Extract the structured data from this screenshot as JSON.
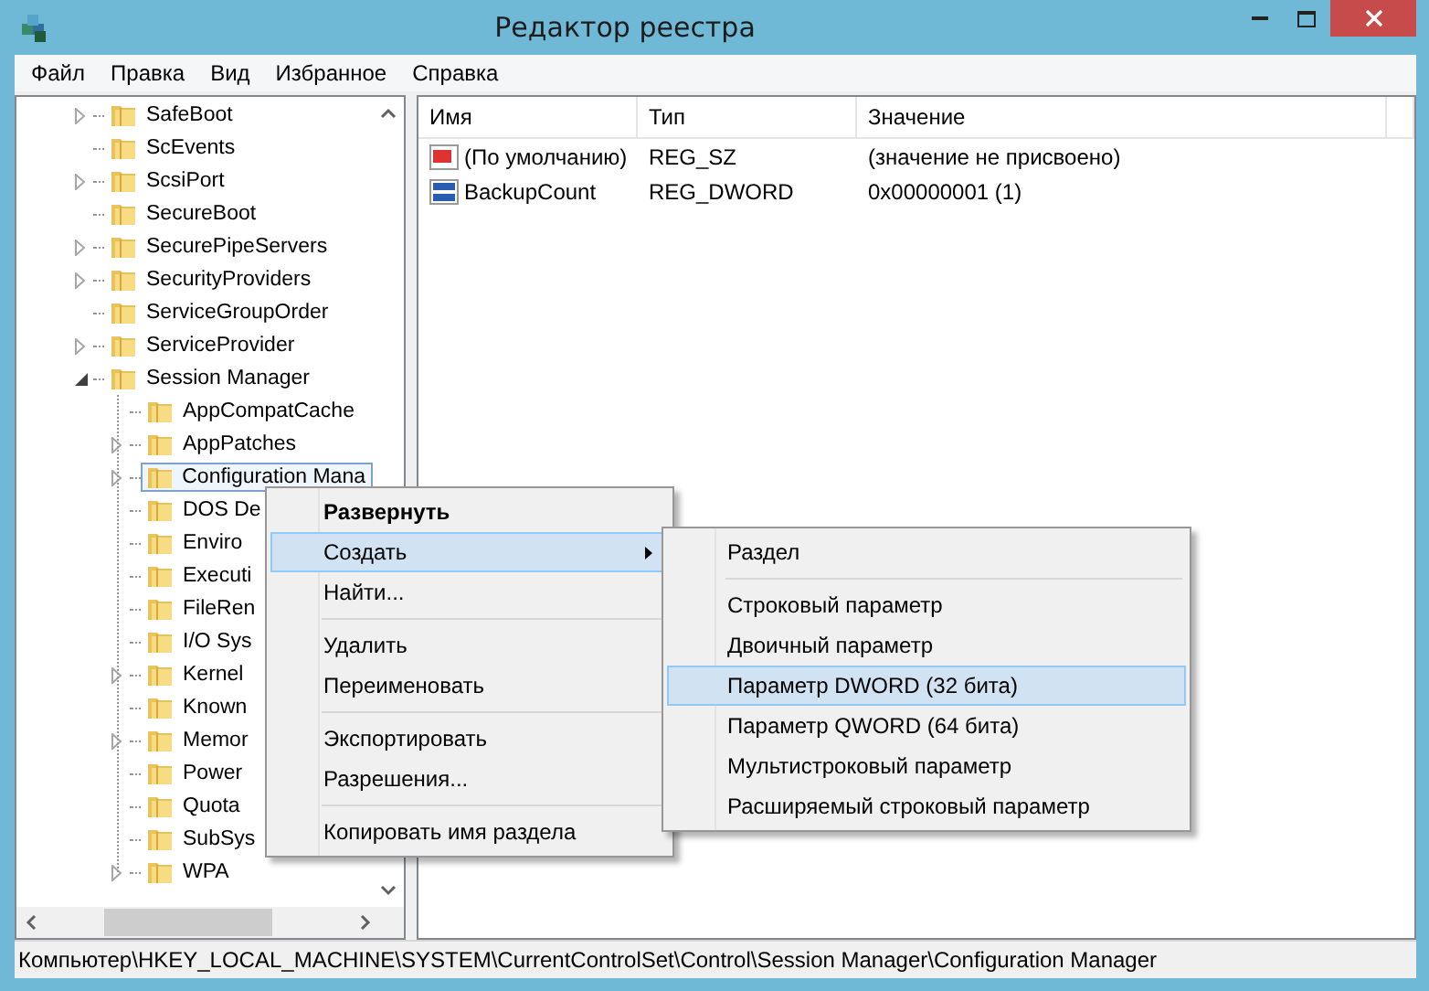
{
  "window": {
    "title": "Редактор реестра"
  },
  "menu_bar": [
    "Файл",
    "Правка",
    "Вид",
    "Избранное",
    "Справка"
  ],
  "tree": {
    "items": [
      {
        "name": "SafeBoot",
        "expandable": true,
        "expanded": false,
        "selected": false
      },
      {
        "name": "ScEvents",
        "expandable": false,
        "selected": false
      },
      {
        "name": "ScsiPort",
        "expandable": true,
        "expanded": false,
        "selected": false
      },
      {
        "name": "SecureBoot",
        "expandable": false,
        "selected": false
      },
      {
        "name": "SecurePipeServers",
        "expandable": true,
        "expanded": false,
        "selected": false
      },
      {
        "name": "SecurityProviders",
        "expandable": true,
        "expanded": false,
        "selected": false
      },
      {
        "name": "ServiceGroupOrder",
        "expandable": false,
        "selected": false
      },
      {
        "name": "ServiceProvider",
        "expandable": true,
        "expanded": false,
        "selected": false
      },
      {
        "name": "Session Manager",
        "expandable": true,
        "expanded": true,
        "selected": false,
        "children": [
          {
            "name": "AppCompatCache",
            "expandable": false,
            "selected": false
          },
          {
            "name": "AppPatches",
            "expandable": true,
            "expanded": false,
            "selected": false
          },
          {
            "name": "Configuration Mana",
            "expandable": true,
            "expanded": false,
            "selected": true
          },
          {
            "name": "DOS De",
            "expandable": false,
            "selected": false
          },
          {
            "name": "Enviro",
            "expandable": false,
            "selected": false
          },
          {
            "name": "Executi",
            "expandable": false,
            "selected": false
          },
          {
            "name": "FileRen",
            "expandable": false,
            "selected": false
          },
          {
            "name": "I/O Sys",
            "expandable": false,
            "selected": false
          },
          {
            "name": "Kernel",
            "expandable": true,
            "expanded": false,
            "selected": false
          },
          {
            "name": "Known",
            "expandable": false,
            "selected": false
          },
          {
            "name": "Memor",
            "expandable": true,
            "expanded": false,
            "selected": false
          },
          {
            "name": "Power",
            "expandable": false,
            "selected": false
          },
          {
            "name": "Quota",
            "expandable": false,
            "selected": false
          },
          {
            "name": "SubSys",
            "expandable": false,
            "selected": false
          },
          {
            "name": "WPA",
            "expandable": true,
            "expanded": false,
            "selected": false
          }
        ]
      }
    ]
  },
  "values": {
    "columns": [
      "Имя",
      "Тип",
      "Значение"
    ],
    "rows": [
      {
        "kind": "string",
        "name": "(По умолчанию)",
        "type": "REG_SZ",
        "data": "(значение не присвоено)"
      },
      {
        "kind": "binary",
        "name": "BackupCount",
        "type": "REG_DWORD",
        "data": "0x00000001 (1)"
      }
    ]
  },
  "context_menu": {
    "items": [
      {
        "kind": "item",
        "label": "Развернуть",
        "bold": true,
        "selected": false,
        "submenu": false
      },
      {
        "kind": "item",
        "label": "Создать",
        "bold": false,
        "selected": true,
        "submenu": true
      },
      {
        "kind": "item",
        "label": "Найти...",
        "bold": false,
        "selected": false,
        "submenu": false
      },
      {
        "kind": "separator"
      },
      {
        "kind": "item",
        "label": "Удалить",
        "bold": false,
        "selected": false,
        "submenu": false
      },
      {
        "kind": "item",
        "label": "Переименовать",
        "bold": false,
        "selected": false,
        "submenu": false
      },
      {
        "kind": "separator"
      },
      {
        "kind": "item",
        "label": "Экспортировать",
        "bold": false,
        "selected": false,
        "submenu": false
      },
      {
        "kind": "item",
        "label": "Разрешения...",
        "bold": false,
        "selected": false,
        "submenu": false
      },
      {
        "kind": "separator"
      },
      {
        "kind": "item",
        "label": "Копировать имя раздела",
        "bold": false,
        "selected": false,
        "submenu": false
      }
    ]
  },
  "submenu": {
    "items": [
      {
        "kind": "item",
        "label": "Раздел",
        "selected": false
      },
      {
        "kind": "separator"
      },
      {
        "kind": "item",
        "label": "Строковый параметр",
        "selected": false
      },
      {
        "kind": "item",
        "label": "Двоичный параметр",
        "selected": false
      },
      {
        "kind": "item",
        "label": "Параметр DWORD (32 бита)",
        "selected": true
      },
      {
        "kind": "item",
        "label": "Параметр QWORD (64 бита)",
        "selected": false
      },
      {
        "kind": "item",
        "label": "Мультистроковый параметр",
        "selected": false
      },
      {
        "kind": "item",
        "label": "Расширяемый строковый параметр",
        "selected": false
      }
    ]
  },
  "status_bar": "Компьютер\\HKEY_LOCAL_MACHINE\\SYSTEM\\CurrentControlSet\\Control\\Session Manager\\Configuration Manager"
}
